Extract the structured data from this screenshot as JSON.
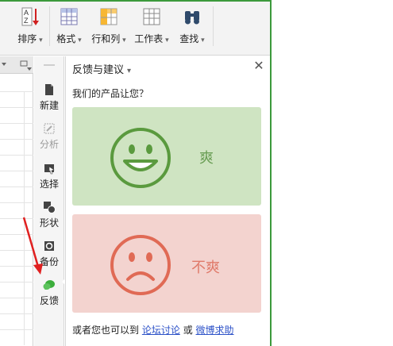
{
  "ribbon": {
    "buttons": [
      {
        "label": "排序",
        "icon": "sort-az-icon"
      },
      {
        "label": "格式",
        "icon": "format-table-icon"
      },
      {
        "label": "行和列",
        "icon": "rows-columns-icon"
      },
      {
        "label": "工作表",
        "icon": "worksheet-icon"
      },
      {
        "label": "查找",
        "icon": "binoculars-icon"
      }
    ]
  },
  "sidebar": {
    "items": [
      {
        "label": "新建",
        "icon": "new-doc-icon",
        "enabled": true
      },
      {
        "label": "分析",
        "icon": "analyze-icon",
        "enabled": false
      },
      {
        "label": "选择",
        "icon": "select-icon",
        "enabled": true
      },
      {
        "label": "形状",
        "icon": "shape-icon",
        "enabled": true
      },
      {
        "label": "备份",
        "icon": "backup-icon",
        "enabled": true
      },
      {
        "label": "反馈",
        "icon": "feedback-chat-icon",
        "enabled": true
      }
    ]
  },
  "panel": {
    "title": "反馈与建议",
    "question": "我们的产品让您？",
    "good_label": "爽",
    "bad_label": "不爽",
    "footer_prefix": "或者您也可以到",
    "footer_link1": "论坛讨论",
    "footer_or": "或",
    "footer_link2": "微博求助",
    "close_glyph": "✕"
  },
  "colors": {
    "good_bg": "#cfe4c2",
    "good_face": "#5a9a3e",
    "bad_bg": "#f3d3cf",
    "bad_face": "#e06a55",
    "link": "#2d52c8",
    "accent_green": "#3c9a3c",
    "arrow_red": "#e02020"
  }
}
